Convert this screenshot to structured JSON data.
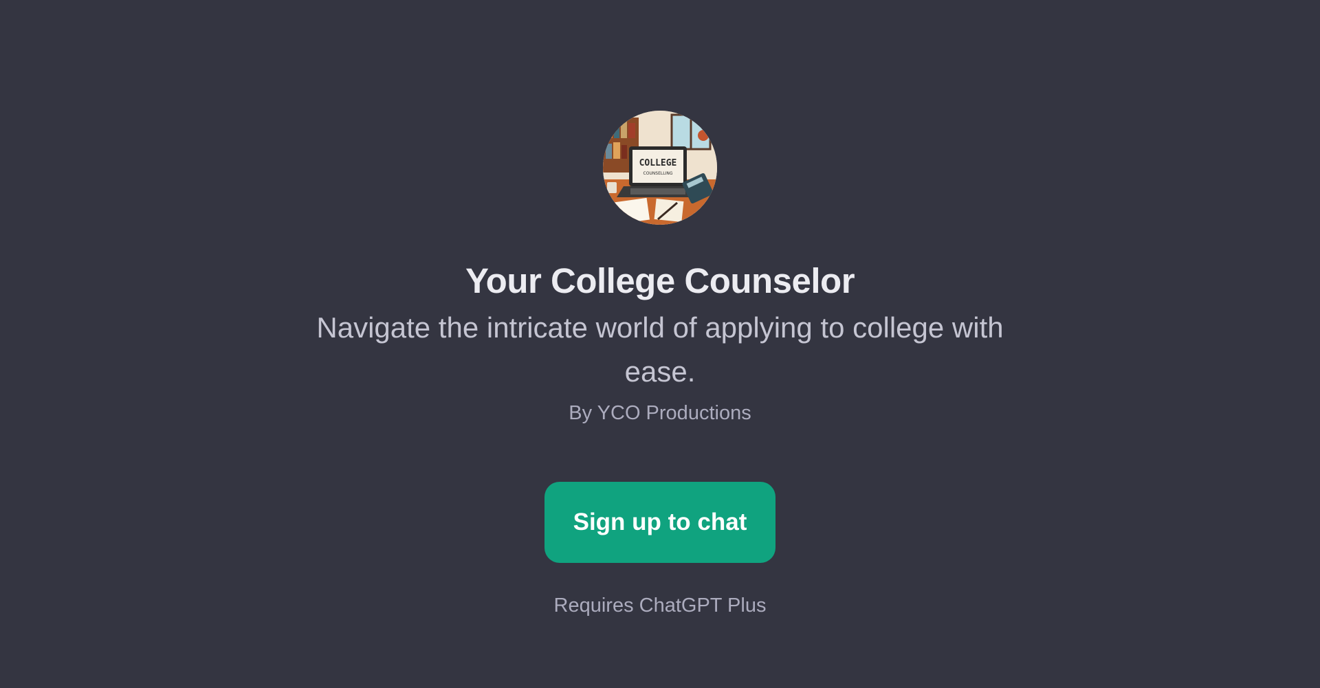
{
  "gpt": {
    "avatar_icon": "college-counseling-illustration-icon",
    "avatar_text_line1": "COLLEGE",
    "avatar_text_line2": "COUNSELLING",
    "title": "Your College Counselor",
    "description": "Navigate the intricate world of applying to college with ease.",
    "author": "By YCO Productions"
  },
  "actions": {
    "signup_label": "Sign up to chat",
    "requirement": "Requires ChatGPT Plus"
  },
  "colors": {
    "background": "#343541",
    "accent": "#10a37f",
    "title": "#ececf1",
    "subtitle": "#c5c5d2",
    "muted": "#acacbe"
  }
}
